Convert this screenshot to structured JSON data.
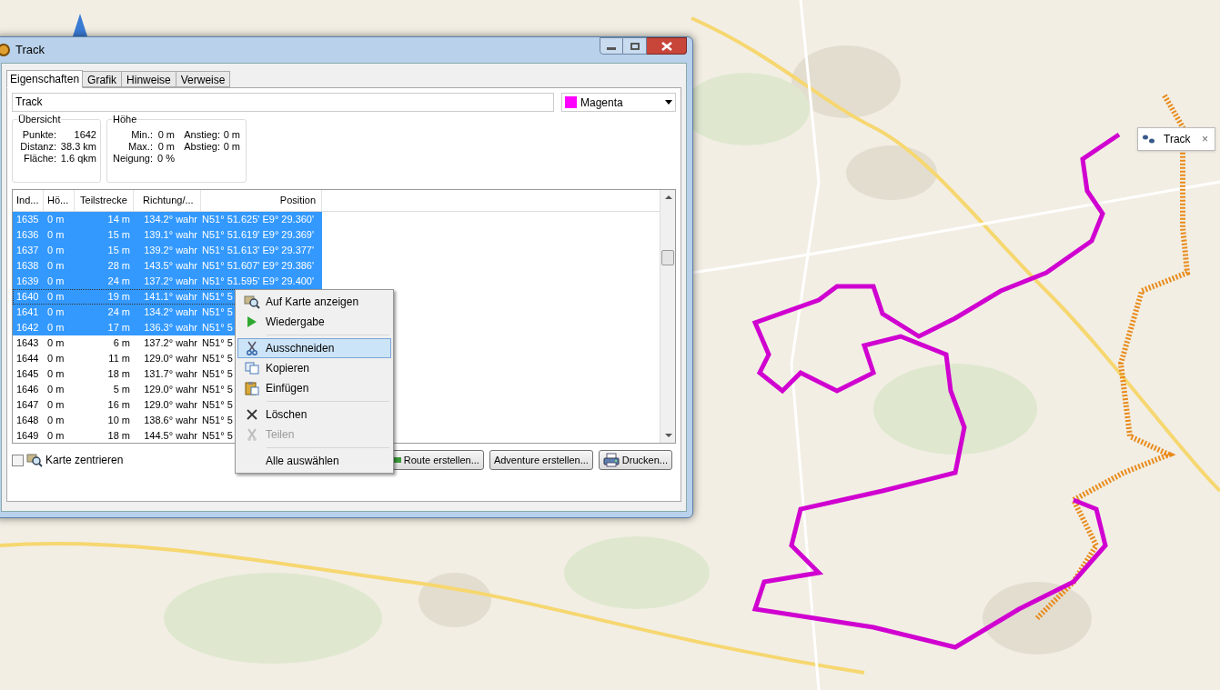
{
  "map_popup": {
    "label": "Track",
    "close": "×"
  },
  "window": {
    "title": "Track"
  },
  "tabs": [
    {
      "label": "Eigenschaften",
      "selected": true
    },
    {
      "label": "Grafik",
      "selected": false
    },
    {
      "label": "Hinweise",
      "selected": false
    },
    {
      "label": "Verweise",
      "selected": false
    }
  ],
  "name_field": {
    "value": "Track"
  },
  "color_dropdown": {
    "value": "Magenta",
    "color": "#ff00ff"
  },
  "overview": {
    "title": "Übersicht",
    "rows": [
      {
        "label": "Punkte:",
        "value": "1642"
      },
      {
        "label": "Distanz:",
        "value": "38.3 km"
      },
      {
        "label": "Fläche:",
        "value": "1.6 qkm"
      }
    ]
  },
  "height": {
    "title": "Höhe",
    "rows": [
      {
        "label": "Min.:",
        "value": "0 m",
        "label_2": "Anstieg:",
        "value_2": "0 m"
      },
      {
        "label": "Max.:",
        "value": "0 m",
        "label_2": "Abstieg:",
        "value_2": "0 m"
      },
      {
        "label": "Neigung:",
        "value": "0 %"
      }
    ]
  },
  "table": {
    "columns": [
      "Ind...",
      "Hö...",
      "Teilstrecke",
      "Richtung/...",
      "Position"
    ],
    "rows": [
      {
        "cells": [
          "1635",
          "0 m",
          "14 m",
          "134.2° wahr",
          "N51° 51.625' E9° 29.360'"
        ],
        "selected": true,
        "focused": false
      },
      {
        "cells": [
          "1636",
          "0 m",
          "15 m",
          "139.1° wahr",
          "N51° 51.619' E9° 29.369'"
        ],
        "selected": true,
        "focused": false
      },
      {
        "cells": [
          "1637",
          "0 m",
          "15 m",
          "139.2° wahr",
          "N51° 51.613' E9° 29.377'"
        ],
        "selected": true,
        "focused": false
      },
      {
        "cells": [
          "1638",
          "0 m",
          "28 m",
          "143.5° wahr",
          "N51° 51.607' E9° 29.386'"
        ],
        "selected": true,
        "focused": false
      },
      {
        "cells": [
          "1639",
          "0 m",
          "24 m",
          "137.2° wahr",
          "N51° 51.595' E9° 29.400'"
        ],
        "selected": true,
        "focused": false
      },
      {
        "cells": [
          "1640",
          "0 m",
          "19 m",
          "141.1° wahr",
          "N51° 5"
        ],
        "selected": true,
        "focused": true
      },
      {
        "cells": [
          "1641",
          "0 m",
          "24 m",
          "134.2° wahr",
          "N51° 5"
        ],
        "selected": true,
        "focused": false
      },
      {
        "cells": [
          "1642",
          "0 m",
          "17 m",
          "136.3° wahr",
          "N51° 5"
        ],
        "selected": true,
        "focused": false
      },
      {
        "cells": [
          "1643",
          "0 m",
          "6 m",
          "137.2° wahr",
          "N51° 5"
        ],
        "selected": false,
        "focused": false
      },
      {
        "cells": [
          "1644",
          "0 m",
          "11 m",
          "129.0° wahr",
          "N51° 5"
        ],
        "selected": false,
        "focused": false
      },
      {
        "cells": [
          "1645",
          "0 m",
          "18 m",
          "131.7° wahr",
          "N51° 5"
        ],
        "selected": false,
        "focused": false
      },
      {
        "cells": [
          "1646",
          "0 m",
          "5 m",
          "129.0° wahr",
          "N51° 5"
        ],
        "selected": false,
        "focused": false
      },
      {
        "cells": [
          "1647",
          "0 m",
          "16 m",
          "129.0° wahr",
          "N51° 5"
        ],
        "selected": false,
        "focused": false
      },
      {
        "cells": [
          "1648",
          "0 m",
          "10 m",
          "138.6° wahr",
          "N51° 5"
        ],
        "selected": false,
        "focused": false
      },
      {
        "cells": [
          "1649",
          "0 m",
          "18 m",
          "144.5° wahr",
          "N51° 5"
        ],
        "selected": false,
        "focused": false
      }
    ]
  },
  "center_map": {
    "label": "Karte zentrieren",
    "checked": false
  },
  "buttons": [
    {
      "label": "Route erstellen...",
      "kind": "route"
    },
    {
      "label": "Adventure erstellen...",
      "kind": "plain"
    },
    {
      "label": "Drucken...",
      "kind": "print"
    }
  ],
  "context_menu": {
    "groups": [
      [
        {
          "label": "Auf Karte anzeigen",
          "kind": "show",
          "selected": false,
          "disabled": false
        },
        {
          "label": "Wiedergabe",
          "kind": "play",
          "selected": false,
          "disabled": false
        }
      ],
      [
        {
          "label": "Ausschneiden",
          "kind": "cut",
          "selected": true,
          "disabled": false
        },
        {
          "label": "Kopieren",
          "kind": "copy",
          "selected": false,
          "disabled": false
        },
        {
          "label": "Einfügen",
          "kind": "paste",
          "selected": false,
          "disabled": false
        }
      ],
      [
        {
          "label": "Löschen",
          "kind": "delete",
          "selected": false,
          "disabled": false
        },
        {
          "label": "Teilen",
          "kind": "split",
          "selected": false,
          "disabled": true
        }
      ],
      [
        {
          "label": "Alle auswählen",
          "kind": "none",
          "selected": false,
          "disabled": false
        }
      ]
    ]
  }
}
